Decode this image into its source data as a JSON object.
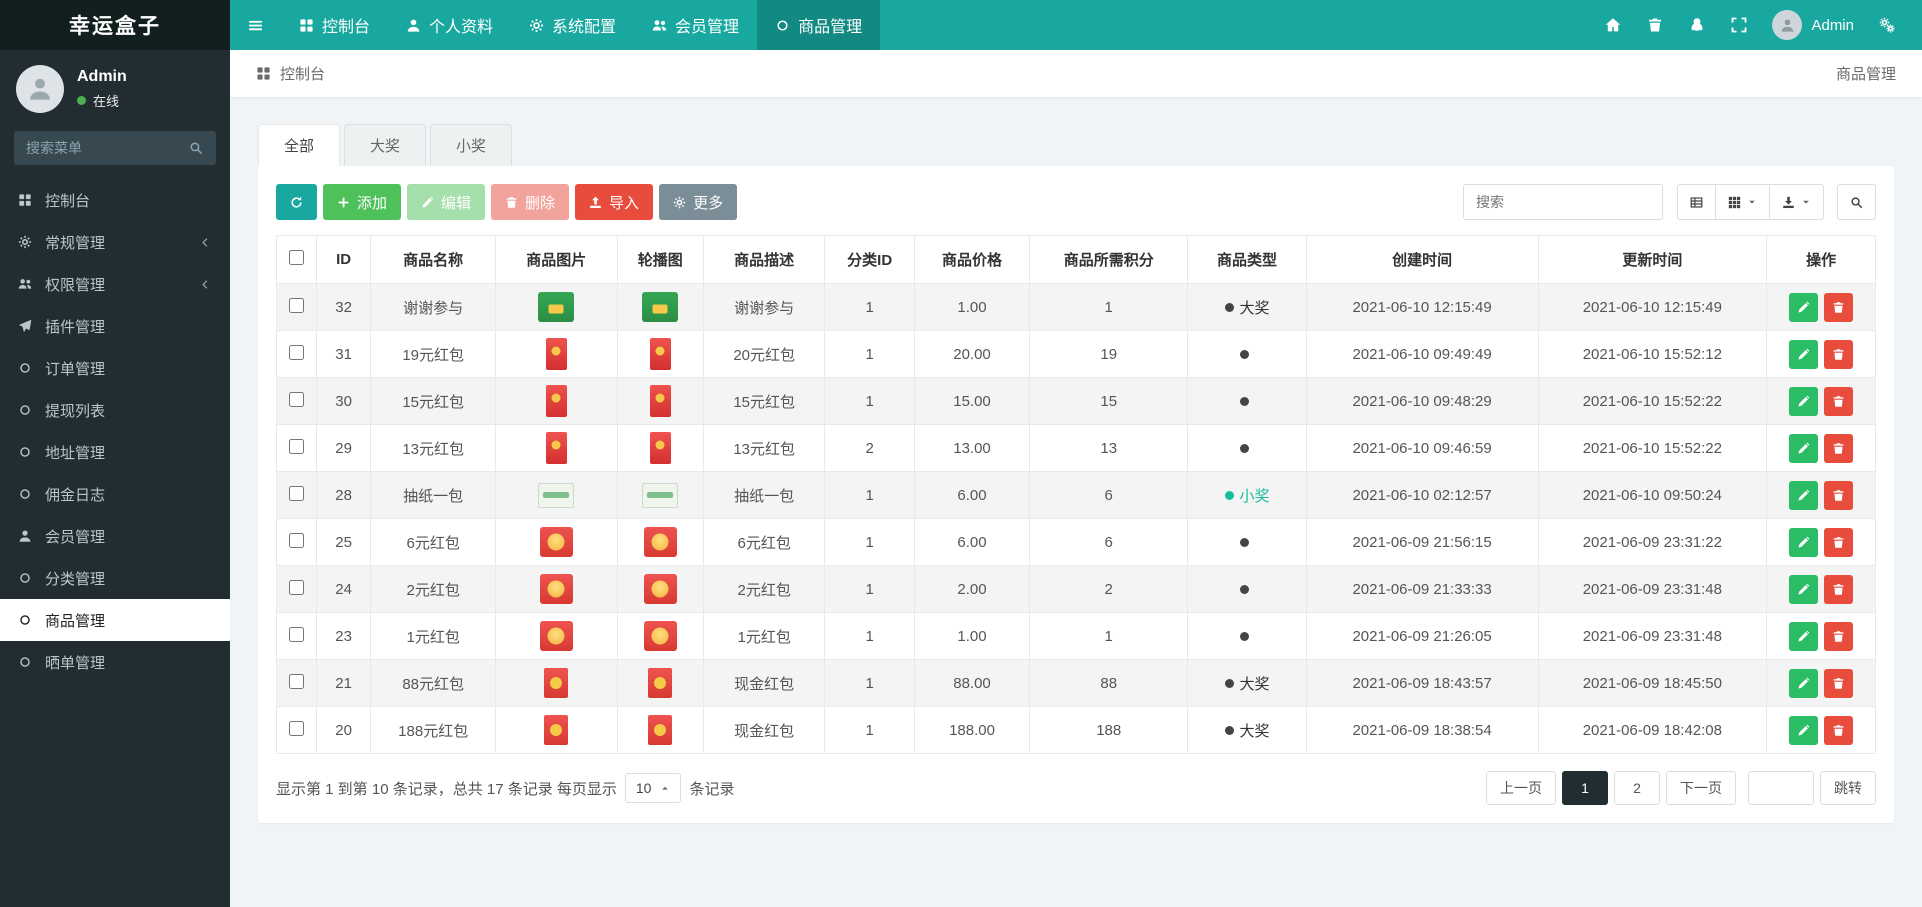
{
  "topnav": {
    "logo": "幸运盒子",
    "menu": [
      {
        "label": "控制台",
        "icon": "dashboard",
        "active": false
      },
      {
        "label": "个人资料",
        "icon": "user",
        "active": false
      },
      {
        "label": "系统配置",
        "icon": "gear",
        "active": false
      },
      {
        "label": "会员管理",
        "icon": "users",
        "active": false
      },
      {
        "label": "商品管理",
        "icon": "circle",
        "active": true
      }
    ],
    "right_icons": [
      "home",
      "trash",
      "service",
      "expand"
    ],
    "admin": {
      "name": "Admin"
    }
  },
  "sidebar": {
    "user": {
      "name": "Admin",
      "status": "在线"
    },
    "search_placeholder": "搜索菜单",
    "menu": [
      {
        "label": "控制台",
        "icon": "dashboard",
        "active": false,
        "chevron": false
      },
      {
        "label": "常规管理",
        "icon": "gear",
        "active": false,
        "chevron": true
      },
      {
        "label": "权限管理",
        "icon": "users",
        "active": false,
        "chevron": true
      },
      {
        "label": "插件管理",
        "icon": "plane",
        "active": false,
        "chevron": false
      },
      {
        "label": "订单管理",
        "icon": "circle",
        "active": false,
        "chevron": false
      },
      {
        "label": "提现列表",
        "icon": "circle",
        "active": false,
        "chevron": false
      },
      {
        "label": "地址管理",
        "icon": "circle",
        "active": false,
        "chevron": false
      },
      {
        "label": "佣金日志",
        "icon": "circle",
        "active": false,
        "chevron": false
      },
      {
        "label": "会员管理",
        "icon": "user",
        "active": false,
        "chevron": false
      },
      {
        "label": "分类管理",
        "icon": "circle",
        "active": false,
        "chevron": false
      },
      {
        "label": "商品管理",
        "icon": "circle",
        "active": true,
        "chevron": false
      },
      {
        "label": "晒单管理",
        "icon": "circle",
        "active": false,
        "chevron": false
      }
    ]
  },
  "breadcrumb": {
    "home": "控制台",
    "current": "商品管理"
  },
  "tabs": [
    {
      "label": "全部",
      "active": true
    },
    {
      "label": "大奖",
      "active": false
    },
    {
      "label": "小奖",
      "active": false
    }
  ],
  "toolbar": {
    "add": "添加",
    "edit": "编辑",
    "delete": "删除",
    "import": "导入",
    "more": "更多",
    "search_placeholder": "搜索"
  },
  "table": {
    "columns": [
      "ID",
      "商品名称",
      "商品图片",
      "轮播图",
      "商品描述",
      "分类ID",
      "商品价格",
      "商品所需积分",
      "商品类型",
      "创建时间",
      "更新时间",
      "操作"
    ],
    "rows": [
      {
        "id": "32",
        "name": "谢谢参与",
        "thumb": "green-card",
        "desc": "谢谢参与",
        "category_id": "1",
        "price": "1.00",
        "points": "1",
        "type": {
          "label": "大奖",
          "variant": "dark"
        },
        "created_at": "2021-06-10 12:15:49",
        "updated_at": "2021-06-10 12:15:49"
      },
      {
        "id": "31",
        "name": "19元红包",
        "thumb": "red-tall",
        "desc": "20元红包",
        "category_id": "1",
        "price": "20.00",
        "points": "19",
        "type": {
          "label": "",
          "variant": "dark"
        },
        "created_at": "2021-06-10 09:49:49",
        "updated_at": "2021-06-10 15:52:12"
      },
      {
        "id": "30",
        "name": "15元红包",
        "thumb": "red-tall",
        "desc": "15元红包",
        "category_id": "1",
        "price": "15.00",
        "points": "15",
        "type": {
          "label": "",
          "variant": "dark"
        },
        "created_at": "2021-06-10 09:48:29",
        "updated_at": "2021-06-10 15:52:22"
      },
      {
        "id": "29",
        "name": "13元红包",
        "thumb": "red-tall",
        "desc": "13元红包",
        "category_id": "2",
        "price": "13.00",
        "points": "13",
        "type": {
          "label": "",
          "variant": "dark"
        },
        "created_at": "2021-06-10 09:46:59",
        "updated_at": "2021-06-10 15:52:22"
      },
      {
        "id": "28",
        "name": "抽纸一包",
        "thumb": "tissue",
        "desc": "抽纸一包",
        "category_id": "1",
        "price": "6.00",
        "points": "6",
        "type": {
          "label": "小奖",
          "variant": "teal"
        },
        "created_at": "2021-06-10 02:12:57",
        "updated_at": "2021-06-10 09:50:24"
      },
      {
        "id": "25",
        "name": "6元红包",
        "thumb": "red-gold",
        "desc": "6元红包",
        "category_id": "1",
        "price": "6.00",
        "points": "6",
        "type": {
          "label": "",
          "variant": "dark"
        },
        "created_at": "2021-06-09 21:56:15",
        "updated_at": "2021-06-09 23:31:22"
      },
      {
        "id": "24",
        "name": "2元红包",
        "thumb": "red-gold",
        "desc": "2元红包",
        "category_id": "1",
        "price": "2.00",
        "points": "2",
        "type": {
          "label": "",
          "variant": "dark"
        },
        "created_at": "2021-06-09 21:33:33",
        "updated_at": "2021-06-09 23:31:48"
      },
      {
        "id": "23",
        "name": "1元红包",
        "thumb": "red-gold",
        "desc": "1元红包",
        "category_id": "1",
        "price": "1.00",
        "points": "1",
        "type": {
          "label": "",
          "variant": "dark"
        },
        "created_at": "2021-06-09 21:26:05",
        "updated_at": "2021-06-09 23:31:48"
      },
      {
        "id": "21",
        "name": "88元红包",
        "thumb": "red-env",
        "desc": "现金红包",
        "category_id": "1",
        "price": "88.00",
        "points": "88",
        "type": {
          "label": "大奖",
          "variant": "dark"
        },
        "created_at": "2021-06-09 18:43:57",
        "updated_at": "2021-06-09 18:45:50"
      },
      {
        "id": "20",
        "name": "188元红包",
        "thumb": "red-env",
        "desc": "现金红包",
        "category_id": "1",
        "price": "188.00",
        "points": "188",
        "type": {
          "label": "大奖",
          "variant": "dark"
        },
        "created_at": "2021-06-09 18:38:54",
        "updated_at": "2021-06-09 18:42:08"
      }
    ]
  },
  "footer": {
    "summary_prefix": "显示第 1 到第 10 条记录，总共 17 条记录 每页显示",
    "page_size": "10",
    "summary_suffix": "条记录",
    "prev": "上一页",
    "pages": [
      {
        "label": "1",
        "active": true
      },
      {
        "label": "2",
        "active": false
      }
    ],
    "next": "下一页",
    "jump": "跳转"
  }
}
